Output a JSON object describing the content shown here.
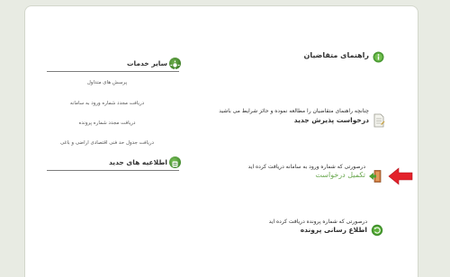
{
  "main": {
    "guide_title": "راهنمای متقاضیان",
    "guide_desc": "چنانچه راهنمای متقاضیان را مطالعه نموده و حائز شرایط می باشید",
    "new_request_label": "درخواست پذیرش جدید",
    "complete_desc": "درصورتی که شماره ورود به سامانه دریافت کرده اید",
    "complete_label": "تکمیل درخواست",
    "status_desc": "درصورتی که شماره پرونده دریافت کرده اید",
    "status_label": "اطلاع رسانی پرونده"
  },
  "sidebar": {
    "services_title": "سایر خدمات",
    "links": [
      "پرسش های متداول",
      "دریافت مجدد شماره ورود به سامانه",
      "دریافت مجدد شماره پرونده",
      "دریافت جدول حد فنی اقتصادی اراضی و باغی"
    ],
    "news_title": "اطلاعیه های جدید"
  },
  "colors": {
    "green_link": "#6aa84f",
    "red_arrow": "#e3222b",
    "icon_green": "#3e8f2a"
  }
}
